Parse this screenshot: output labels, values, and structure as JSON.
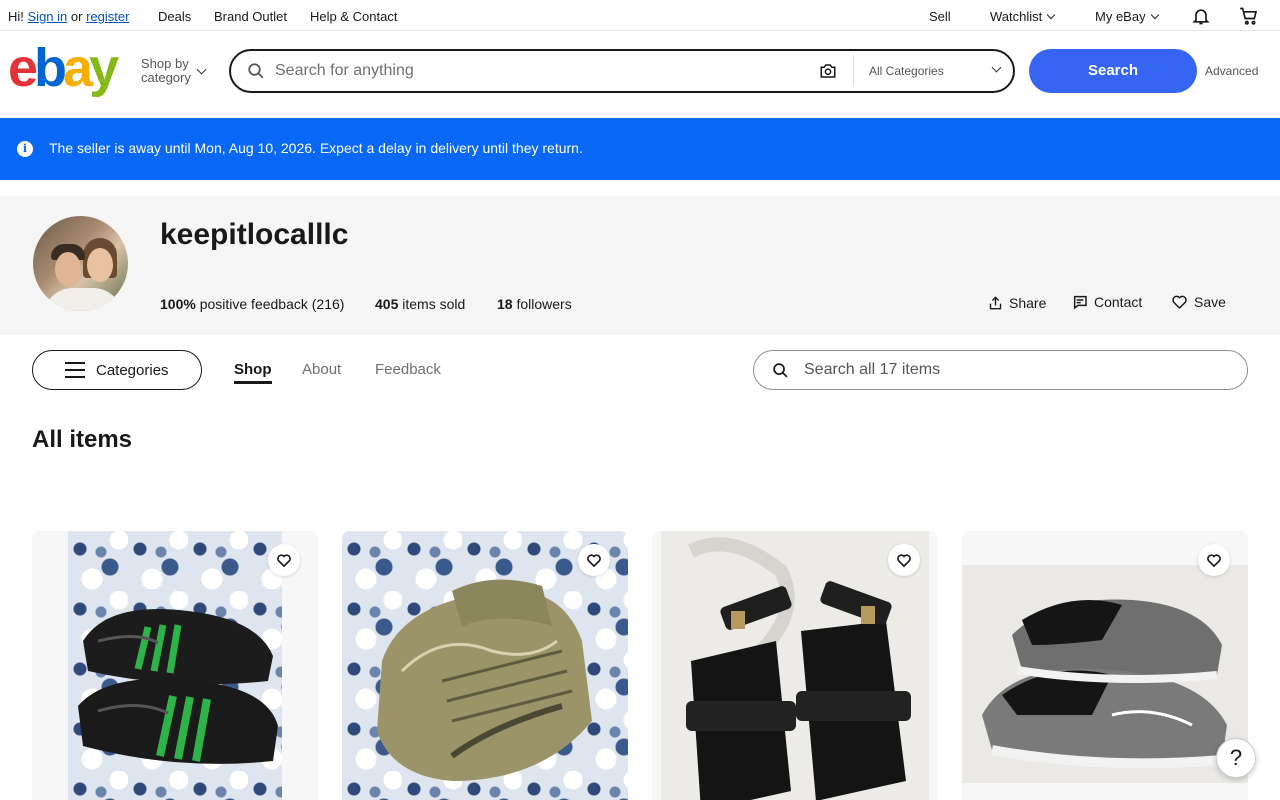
{
  "topbar": {
    "greeting": "Hi!",
    "sign_in": "Sign in",
    "or": "or",
    "register": "register",
    "links": [
      "Deals",
      "Brand Outlet",
      "Help & Contact"
    ],
    "sell": "Sell",
    "watchlist": "Watchlist",
    "my_ebay": "My eBay"
  },
  "header": {
    "logo": [
      "e",
      "b",
      "a",
      "y"
    ],
    "shop_by_category": [
      "Shop by",
      "category"
    ],
    "search_placeholder": "Search for anything",
    "category_select": "All Categories",
    "search_button": "Search",
    "advanced": "Advanced"
  },
  "banner": {
    "message": "The seller is away until Mon, Aug 10, 2026. Expect a delay in delivery until they return."
  },
  "store": {
    "name": "keepitlocalllc",
    "feedback_pct": "100%",
    "feedback_text": "positive feedback (216)",
    "items_sold_count": "405",
    "items_sold_text": "items sold",
    "followers_count": "18",
    "followers_text": "followers",
    "share": "Share",
    "contact": "Contact",
    "save": "Save"
  },
  "nav": {
    "categories": "Categories",
    "tabs": [
      {
        "label": "Shop",
        "active": true
      },
      {
        "label": "About",
        "active": false
      },
      {
        "label": "Feedback",
        "active": false
      }
    ],
    "store_search_placeholder": "Search all 17 items"
  },
  "section": {
    "heading": "All items"
  },
  "items": [
    {
      "description": "black sneakers with green stripes on paisley fabric"
    },
    {
      "description": "olive Gore-Tex knit sneakers on paisley fabric"
    },
    {
      "description": "black strappy sandals on white fabric"
    },
    {
      "description": "grey On running shoes on white fabric"
    }
  ],
  "help": "?",
  "colors": {
    "banner": "#0968f6",
    "search_button": "#3665f3",
    "link": "#0654ba"
  }
}
